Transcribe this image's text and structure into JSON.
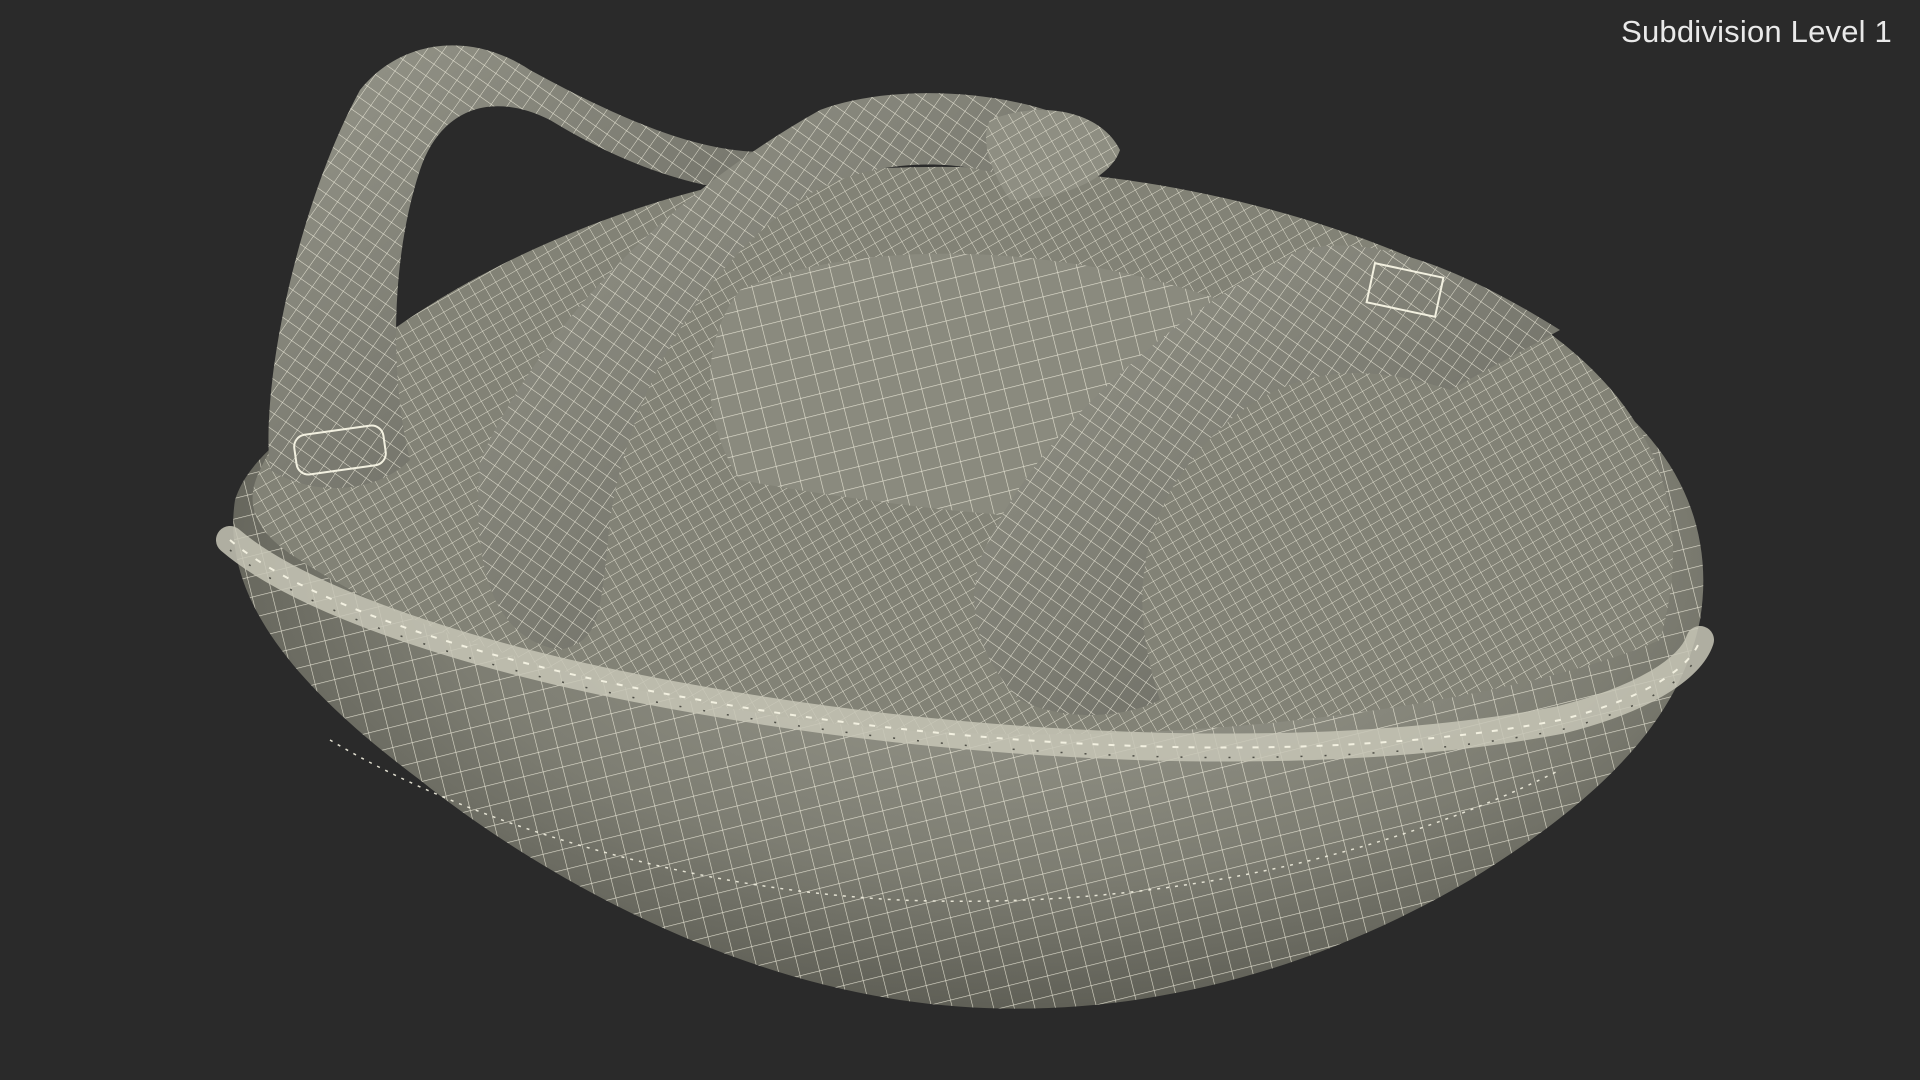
{
  "overlay": {
    "label": "Subdivision Level 1"
  },
  "model": {
    "icon": "wireframe-kick-pad-model"
  },
  "colors": {
    "background": "#2a2a2a",
    "surface": "#7d7d72",
    "surface_light": "#a3a397",
    "surface_dark": "#4f4f47",
    "wire": "#f2f0e0"
  }
}
